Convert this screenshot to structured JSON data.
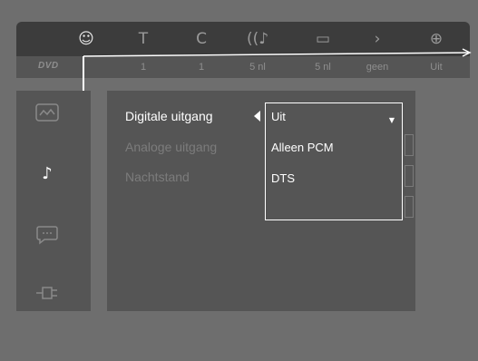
{
  "topbar": {
    "icons": [
      {
        "name": "setup-icon",
        "glyph": "☺",
        "active": true
      },
      {
        "name": "title-icon",
        "glyph": "T",
        "active": false
      },
      {
        "name": "chapter-icon",
        "glyph": "C",
        "active": false
      },
      {
        "name": "audio-icon",
        "glyph": "((♪",
        "active": false
      },
      {
        "name": "subtitle-icon",
        "glyph": "▭",
        "active": false
      },
      {
        "name": "angle-icon",
        "glyph": "›",
        "active": false
      },
      {
        "name": "zoom-icon",
        "glyph": "⊕",
        "active": false
      }
    ]
  },
  "infobar": {
    "logo": "DVD",
    "values": [
      "1",
      "1",
      "5 nl",
      "5 nl",
      "geen",
      "Uit"
    ]
  },
  "sidebar": {
    "icons": [
      {
        "name": "picture-icon",
        "glyph": "▭",
        "active": false
      },
      {
        "name": "music-note-icon",
        "glyph": "♪",
        "active": true
      },
      {
        "name": "speech-bubble-icon",
        "glyph": "💬",
        "active": false
      },
      {
        "name": "plug-icon",
        "glyph": "⊂",
        "active": false
      }
    ]
  },
  "menu": {
    "items": [
      {
        "label": "Digitale uitgang",
        "active": true
      },
      {
        "label": "Analoge uitgang",
        "active": false
      },
      {
        "label": "Nachtstand",
        "active": false
      }
    ]
  },
  "dropdown": {
    "options": [
      "Uit",
      "Alleen PCM",
      "DTS"
    ]
  }
}
